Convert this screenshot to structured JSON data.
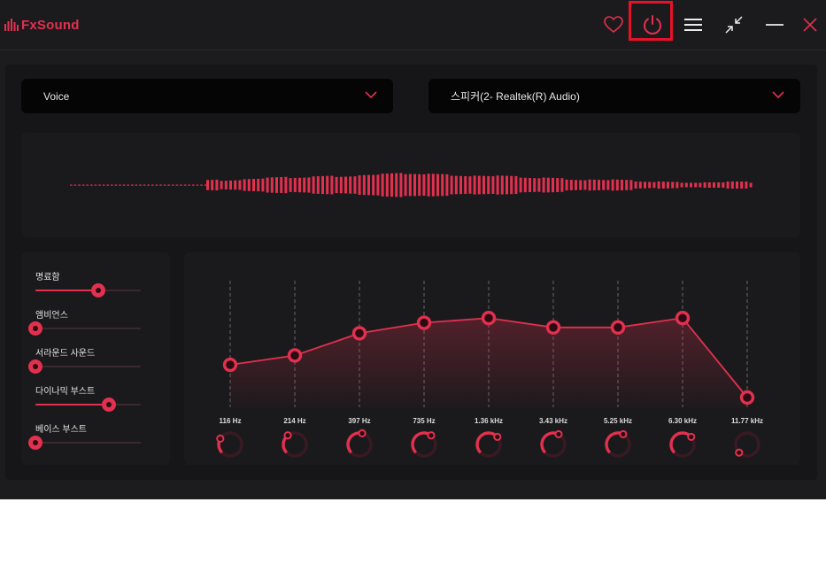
{
  "app": {
    "name": "FxSound",
    "accent": "#e2304f",
    "highlight": "#e8112a"
  },
  "titlebar": {
    "icons": [
      "heart-icon",
      "power-icon",
      "menu-icon",
      "minimize-to-tray-icon",
      "minimize-icon",
      "close-icon"
    ]
  },
  "preset": {
    "selected": "Voice"
  },
  "output_device": {
    "selected": "스피커(2- Realtek(R) Audio)"
  },
  "effects": [
    {
      "label": "명료함",
      "value": 0.6
    },
    {
      "label": "앰비언스",
      "value": 0.0
    },
    {
      "label": "서라운드 사운드",
      "value": 0.0
    },
    {
      "label": "다이나믹 부스트",
      "value": 0.7
    },
    {
      "label": "베이스 부스트",
      "value": 0.0
    }
  ],
  "eq": {
    "bands": [
      {
        "freq": "116 Hz",
        "level": 0.28
      },
      {
        "freq": "214 Hz",
        "level": 0.36
      },
      {
        "freq": "397 Hz",
        "level": 0.55
      },
      {
        "freq": "735 Hz",
        "level": 0.64
      },
      {
        "freq": "1.36 kHz",
        "level": 0.68
      },
      {
        "freq": "3.43 kHz",
        "level": 0.6
      },
      {
        "freq": "5.25 kHz",
        "level": 0.6
      },
      {
        "freq": "6.30 kHz",
        "level": 0.68
      },
      {
        "freq": "11.77 kHz",
        "level": 0.0
      }
    ]
  }
}
